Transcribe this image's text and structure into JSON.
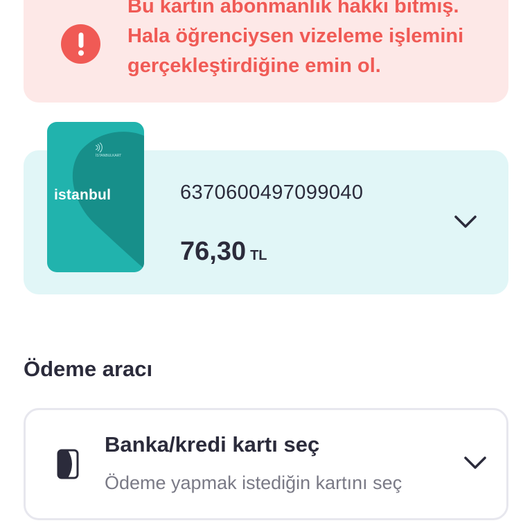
{
  "alert": {
    "message": "Bu kartın abonmanlık hakkı bitmiş. Hala öğrenciysen vizeleme işlemini gerçekleştirdiğine emin ol.",
    "icon": "exclamation-icon",
    "color": "#f05a55",
    "background": "#fde8e7"
  },
  "card": {
    "brand": "istanbul",
    "small_text": "İSTANBULKART",
    "number": "6370600497099040",
    "balance": "76,30",
    "currency": "TL",
    "color": "#21b3ad",
    "panel_background": "#e1f6f7"
  },
  "payment": {
    "section_title": "Ödeme aracı",
    "title": "Banka/kredi kartı seç",
    "subtitle": "Ödeme yapmak istediğin kartını seç",
    "icon": "wallet-icon"
  }
}
